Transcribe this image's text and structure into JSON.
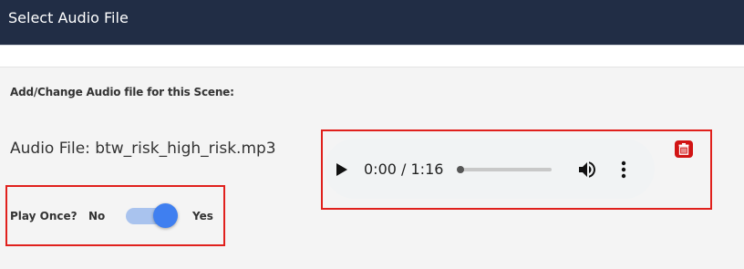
{
  "header": {
    "title": "Select Audio File"
  },
  "section": {
    "label": "Add/Change Audio file for this Scene:"
  },
  "audio": {
    "file_label": "Audio File: btw_risk_high_risk.mp3",
    "time_display": "0:00 / 1:16",
    "progress_fraction": 0.0
  },
  "play_once": {
    "question": "Play Once?",
    "no_label": "No",
    "yes_label": "Yes",
    "value": "Yes"
  },
  "colors": {
    "header_bg": "#212d45",
    "highlight": "#e0201c",
    "toggle_accent": "#3f7ff0",
    "delete_red": "#d11414"
  },
  "icons": [
    "play-icon",
    "volume-icon",
    "more-vertical-icon",
    "trash-icon"
  ]
}
